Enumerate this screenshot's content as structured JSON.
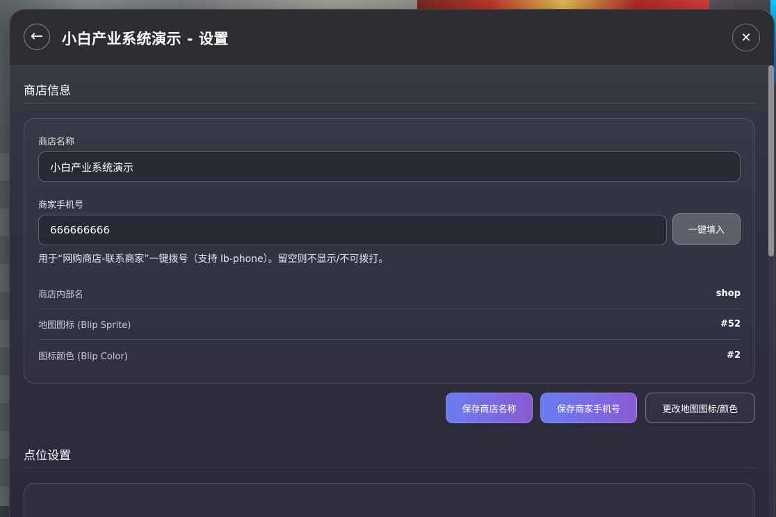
{
  "header": {
    "back_icon": "←",
    "title": "小白产业系统演示 - 设置",
    "close_icon": "✕"
  },
  "shop_info": {
    "section_title": "商店信息",
    "name_label": "商店名称",
    "name_value": "小白产业系统演示",
    "phone_label": "商家手机号",
    "phone_value": "666666666",
    "fill_button": "一键填入",
    "hint": "用于“网购商店-联系商家”一键拨号（支持 lb-phone）。留空则不显示/不可拨打。",
    "rows": [
      {
        "label": "商店内部名",
        "value": "shop"
      },
      {
        "label": "地图图标 (Blip Sprite)",
        "value": "#52"
      },
      {
        "label": "图标颜色 (Blip Color)",
        "value": "#2"
      }
    ],
    "actions": {
      "save_name": "保存商店名称",
      "save_phone": "保存商家手机号",
      "change_blip": "更改地图图标/颜色"
    }
  },
  "point_settings": {
    "section_title": "点位设置"
  },
  "colors": {
    "accent_start": "#6a7cf2",
    "accent_end": "#8a5ad2",
    "panel_bg": "#2f3340"
  }
}
